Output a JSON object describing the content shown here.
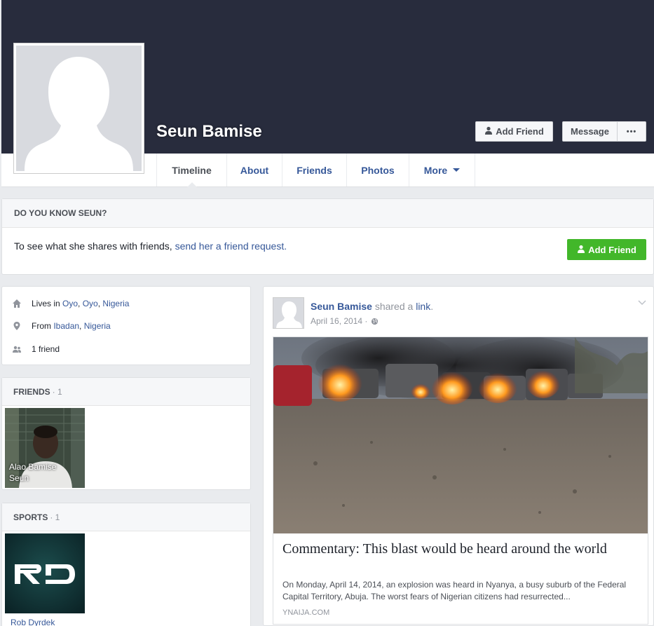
{
  "profile": {
    "name": "Seun Bamise",
    "add_friend_label": "Add Friend",
    "message_label": "Message",
    "more_label": "•••"
  },
  "nav": {
    "tabs": [
      {
        "label": "Timeline"
      },
      {
        "label": "About"
      },
      {
        "label": "Friends"
      },
      {
        "label": "Photos"
      },
      {
        "label": "More"
      }
    ]
  },
  "know_box": {
    "header": "DO YOU KNOW SEUN?",
    "text": "To see what she shares with friends, ",
    "link": "send her a friend request.",
    "button_label": "Add Friend"
  },
  "intro": {
    "lives_prefix": "Lives in ",
    "lives_city": "Oyo",
    "lives_state": "Oyo",
    "lives_country": "Nigeria",
    "from_prefix": "From ",
    "from_city": "Ibadan",
    "from_country": "Nigeria",
    "friends_count": "1 friend"
  },
  "friends_section": {
    "title": "FRIENDS",
    "count": "· 1",
    "items": [
      {
        "name": "Alao Bamise Seun"
      }
    ]
  },
  "sports_section": {
    "title": "SPORTS",
    "count": "· 1",
    "items": [
      {
        "name": "Rob Dyrdek"
      }
    ]
  },
  "post": {
    "author": "Seun Bamise",
    "action": " shared a ",
    "action_link": "link",
    "action_end": ".",
    "date": "April 16, 2014 ·",
    "preview": {
      "title": "Commentary: This blast would be heard around the world",
      "description": "On Monday, April 14, 2014, an explosion was heard in Nyanya, a busy suburb of the Federal Capital Territory, Abuja. The worst fears of Nigerian citizens had resurrected...",
      "source": "YNAIJA.COM"
    }
  },
  "colors": {
    "cover": "#282c3d",
    "link": "#365899",
    "green": "#42b72a"
  }
}
